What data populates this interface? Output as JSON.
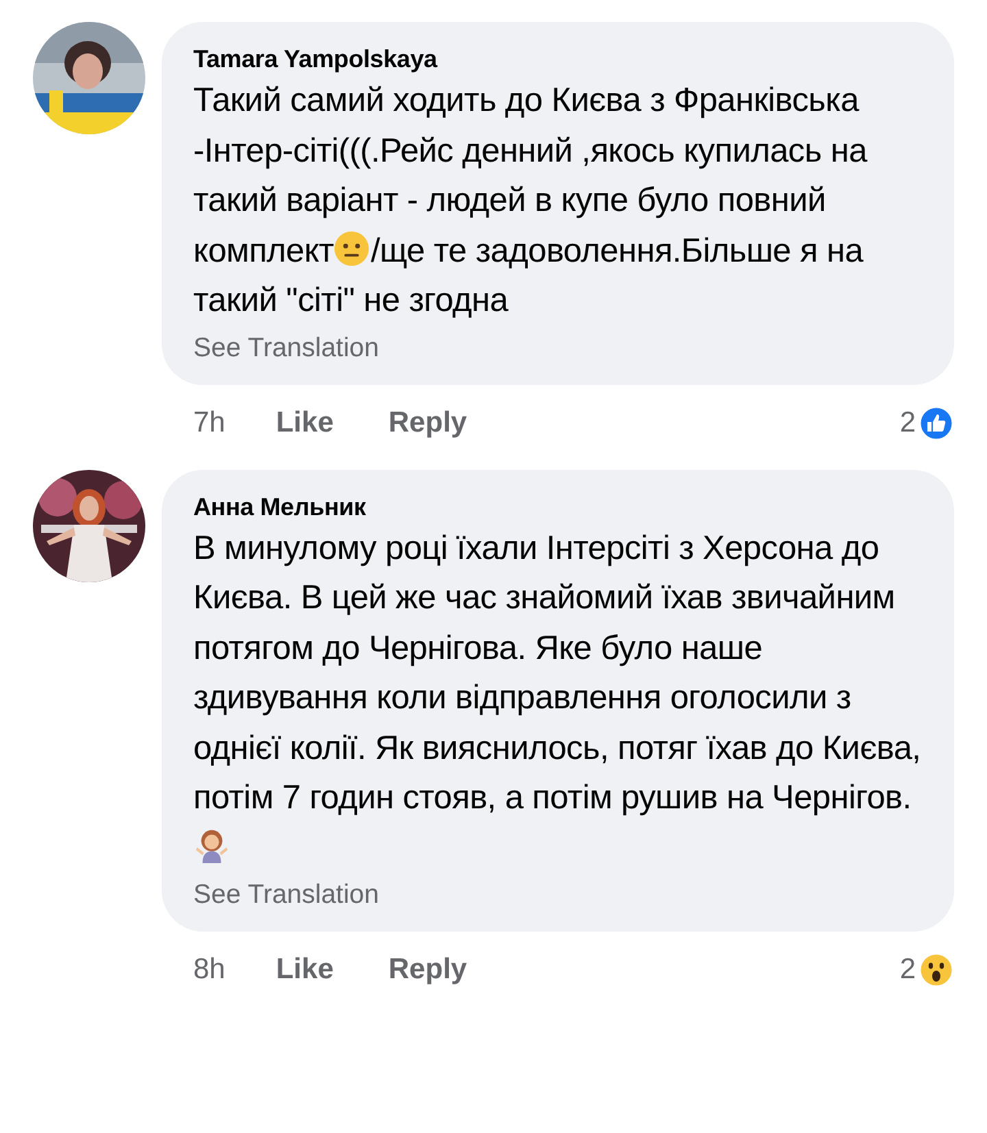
{
  "comments": [
    {
      "avatar": {
        "kind": "picture"
      },
      "author": "Tamara Yampolskaya",
      "body": [
        {
          "kind": "text",
          "text": "Такий самий ходить до Києва з Франківська -Інтер-сіті(((.Рейс денний ,якось купилась на такий варіант - людей в купе було повний комплект"
        },
        {
          "kind": "neutral"
        },
        {
          "kind": "text",
          "text": "/ще те задоволення.Більше я на такий \"сіті\" не згодна"
        }
      ],
      "translate": "See Translation",
      "time": "7h",
      "like": "Like",
      "reply": "Reply",
      "reaction": {
        "count": "2",
        "kind": "like"
      }
    },
    {
      "avatar": {
        "kind": "picture"
      },
      "author": "Анна Мельник",
      "body": [
        {
          "kind": "text",
          "text": "В минулому році їхали Інтерсіті з Херсона до Києва. В цей же час знайомий їхав звичайним потягом до Чернігова. Яке було наше здивування коли відправлення оголосили з однієї колії. Як вияснилось, потяг їхав до Києва, потім 7 годин стояв, а потім рушив на Чернігов. "
        },
        {
          "kind": "shrug"
        }
      ],
      "translate": "See Translation",
      "time": "8h",
      "like": "Like",
      "reply": "Reply",
      "reaction": {
        "count": "2",
        "kind": "wow"
      }
    }
  ]
}
